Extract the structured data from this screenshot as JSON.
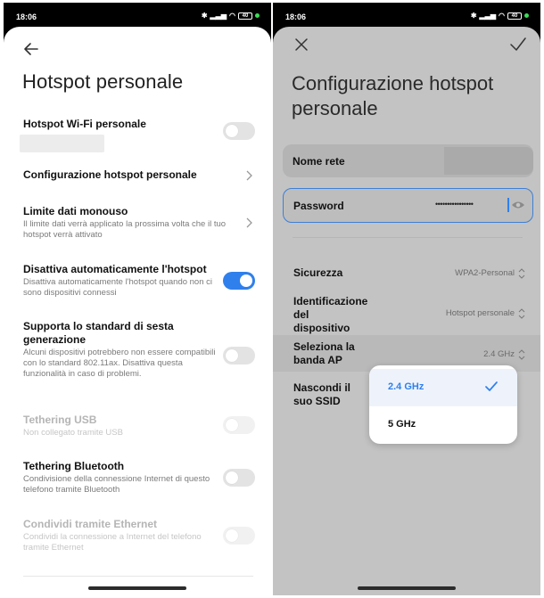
{
  "left": {
    "status": {
      "time": "18:06",
      "battery": "40"
    },
    "page_title": "Hotspot personale",
    "rows": {
      "wifi": {
        "title": "Hotspot Wi-Fi personale"
      },
      "config": {
        "title": "Configurazione hotspot personale"
      },
      "limit": {
        "title": "Limite dati monouso",
        "desc": "Il limite dati verrà applicato la prossima volta che il tuo hotspot verrà attivato"
      },
      "auto_off": {
        "title": "Disattiva automaticamente l'hotspot",
        "desc": "Disattiva automaticamente l'hotspot quando non ci sono dispositivi connessi"
      },
      "gen6": {
        "title": "Supporta lo standard di sesta generazione",
        "desc": "Alcuni dispositivi potrebbero non essere compatibili con lo standard 802.11ax. Disattiva questa funzionalità in caso di problemi."
      },
      "usb": {
        "title": "Tethering USB",
        "desc": "Non collegato tramite USB"
      },
      "bt": {
        "title": "Tethering Bluetooth",
        "desc": "Condivisione della connessione Internet di questo telefono tramite Bluetooth"
      },
      "eth": {
        "title": "Condividi tramite Ethernet",
        "desc": "Condividi la connessione a Internet del telefono tramite Ethernet"
      }
    },
    "toggles": {
      "wifi": false,
      "auto_off": true,
      "gen6": false,
      "usb": false,
      "bt": false,
      "eth": false
    },
    "accent": "#2f80ed"
  },
  "right": {
    "status": {
      "time": "18:06",
      "battery": "40"
    },
    "page_title": "Configurazione hotspot personale",
    "network_name_label": "Nome rete",
    "password_label": "Password",
    "password_value": "••••••••••••••••",
    "security": {
      "label": "Sicurezza",
      "value": "WPA2-Personal"
    },
    "device_id": {
      "label": "Identificazione del dispositivo",
      "value": "Hotspot personale"
    },
    "band": {
      "label": "Seleziona la banda AP",
      "value": "2.4 GHz"
    },
    "hide_ssid": {
      "label": "Nascondi il suo SSID"
    },
    "band_options": [
      "2.4 GHz",
      "5 GHz"
    ],
    "band_selected": "2.4 GHz"
  }
}
